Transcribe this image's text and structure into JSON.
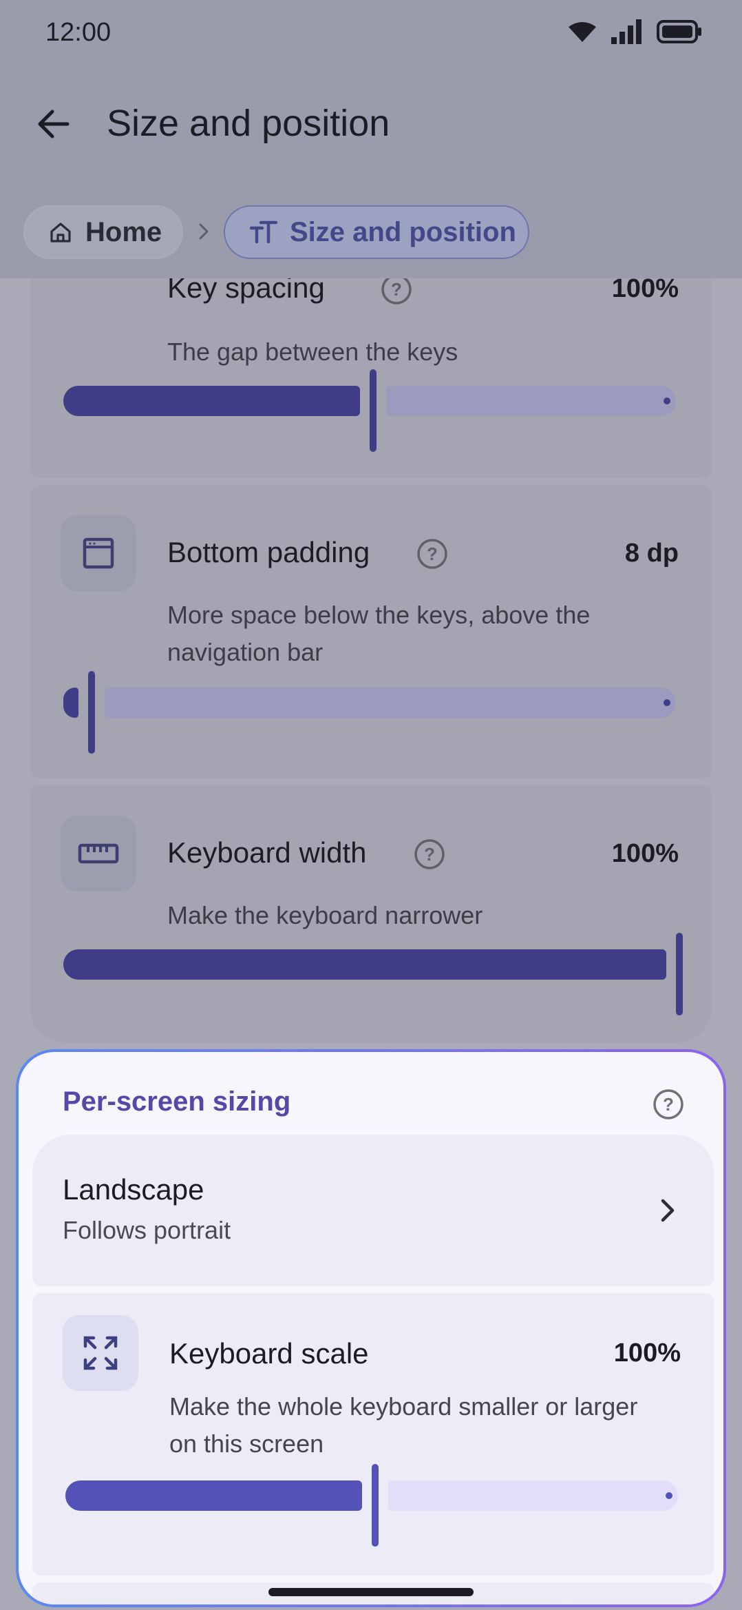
{
  "status_bar": {
    "time": "12:00"
  },
  "header": {
    "title": "Size and position"
  },
  "breadcrumb": [
    {
      "label": "Home",
      "icon": "home-icon"
    },
    {
      "label": "Size and position",
      "icon": "text-size-icon"
    }
  ],
  "settings": [
    {
      "name": "Key spacing",
      "value": "100%",
      "description": "The gap between the keys",
      "level": 0.5,
      "icon": "key-spacing-icon"
    },
    {
      "name": "Bottom padding",
      "value": "8 dp",
      "description": "More space below the keys, above the navigation bar",
      "level": 0.04,
      "icon": "bottom-padding-icon"
    },
    {
      "name": "Keyboard width",
      "value": "100%",
      "description": "Make the keyboard narrower",
      "level": 1.0,
      "icon": "ruler-icon"
    }
  ],
  "per_screen": {
    "title": "Per-screen sizing",
    "landscape": {
      "title": "Landscape",
      "subtitle": "Follows portrait"
    },
    "scale": {
      "name": "Keyboard scale",
      "value": "100%",
      "description": "Make the whole keyboard smaller or larger on this screen",
      "level": 0.5,
      "icon": "expand-icon"
    }
  },
  "colors": {
    "accent": "#5352b6",
    "panel_border_start": "#5a88f2",
    "panel_border_end": "#8c63f0"
  }
}
